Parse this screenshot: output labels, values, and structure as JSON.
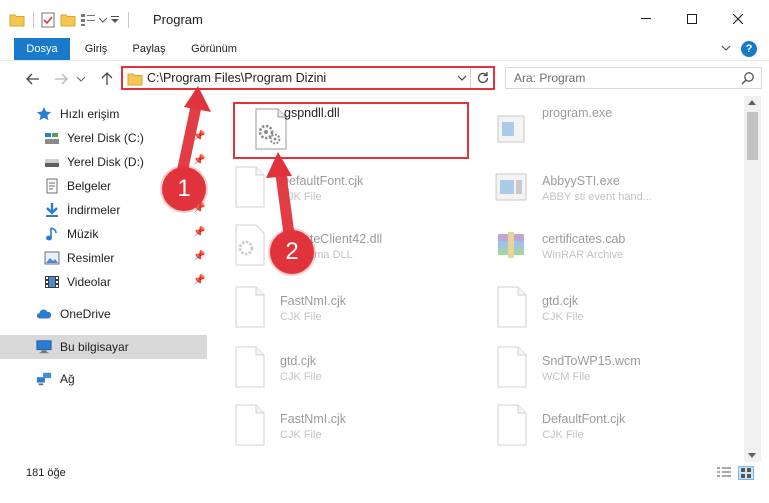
{
  "window": {
    "title": "Program"
  },
  "ribbon": {
    "tabs": [
      {
        "label": "Dosya",
        "active": true
      },
      {
        "label": "Giriş",
        "active": false
      },
      {
        "label": "Paylaş",
        "active": false
      },
      {
        "label": "Görünüm",
        "active": false
      }
    ]
  },
  "address": {
    "path": "C:\\Program Files\\Program Dizini"
  },
  "search": {
    "placeholder": "Ara: Program"
  },
  "nav": {
    "items": [
      {
        "label": "Hızlı erişim",
        "icon": "star-icon",
        "pinned": false
      },
      {
        "label": "Yerel Disk (C:)",
        "icon": "drive-icon",
        "pinned": true
      },
      {
        "label": "Yerel Disk (D:)",
        "icon": "drive-icon",
        "pinned": true
      },
      {
        "label": "Belgeler",
        "icon": "documents-icon",
        "pinned": true
      },
      {
        "label": "İndirmeler",
        "icon": "download-icon",
        "pinned": true
      },
      {
        "label": "Müzik",
        "icon": "music-icon",
        "pinned": true
      },
      {
        "label": "Resimler",
        "icon": "pictures-icon",
        "pinned": true
      },
      {
        "label": "Videolar",
        "icon": "videos-icon",
        "pinned": true
      },
      {
        "label": "OneDrive",
        "icon": "cloud-icon",
        "pinned": false
      },
      {
        "label": "Bu bilgisayar",
        "icon": "computer-icon",
        "pinned": false,
        "selected": true
      },
      {
        "label": "Ağ",
        "icon": "network-icon",
        "pinned": false
      }
    ]
  },
  "files": [
    {
      "name": "gspndll.dll",
      "type": "",
      "icon": "dll-icon"
    },
    {
      "name": "program.exe",
      "type": "",
      "icon": "exe-icon"
    },
    {
      "name": "DefaultFont.cjk",
      "type": "CJK File",
      "icon": "file-icon"
    },
    {
      "name": "AbbyySTI.exe",
      "type": "ABBY sti event hand...",
      "icon": "exe-icon"
    },
    {
      "name": "UpdateClient42.dll",
      "type": "Uygulama DLL",
      "icon": "dll-icon"
    },
    {
      "name": "certificates.cab",
      "type": "WinRAR Archive",
      "icon": "archive-icon"
    },
    {
      "name": "FastNmI.cjk",
      "type": "CJK File",
      "icon": "file-icon"
    },
    {
      "name": "gtd.cjk",
      "type": "CJK File",
      "icon": "file-icon"
    },
    {
      "name": "gtd.cjk",
      "type": "CJK File",
      "icon": "file-icon"
    },
    {
      "name": "SndToWP15.wcm",
      "type": "WCM File",
      "icon": "file-icon"
    },
    {
      "name": "FastNmI.cjk",
      "type": "CJK File",
      "icon": "file-icon"
    },
    {
      "name": "DefaultFont.cjk",
      "type": "CJK File",
      "icon": "file-icon"
    }
  ],
  "status": {
    "count": "181 öğe"
  },
  "callouts": {
    "one": "1",
    "two": "2"
  },
  "colors": {
    "accent": "#1979ca",
    "highlight": "#e0333b",
    "selected": "#d9d9d9"
  }
}
